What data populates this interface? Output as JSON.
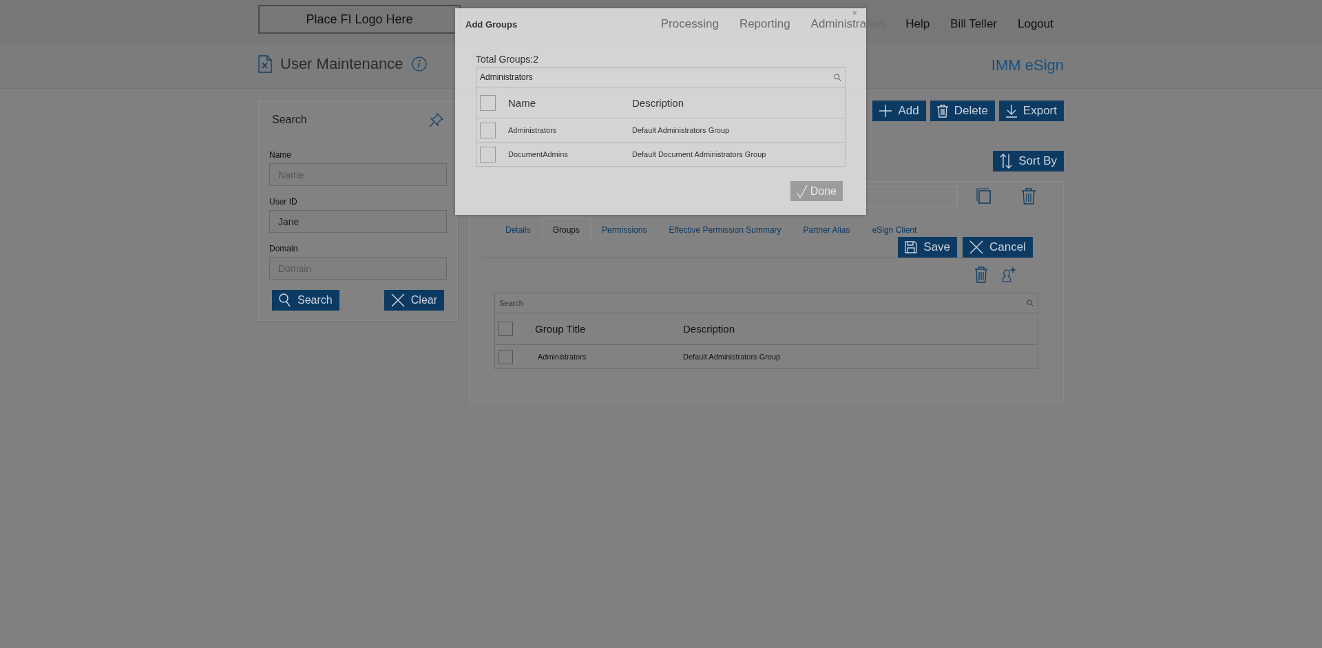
{
  "header": {
    "logo": "Place FI Logo Here",
    "nav": [
      {
        "label": "Processing"
      },
      {
        "label": "Reporting"
      },
      {
        "label": "Administration"
      },
      {
        "label": "Help"
      },
      {
        "label": "Bill Teller"
      },
      {
        "label": "Logout"
      }
    ]
  },
  "page": {
    "title": "User Maintenance",
    "app_name": "IMM eSign"
  },
  "search_panel": {
    "title": "Search",
    "fields": [
      {
        "label": "Name",
        "placeholder": "Name"
      },
      {
        "label": "User ID",
        "value": "Jane"
      },
      {
        "label": "Domain",
        "placeholder": "Domain"
      }
    ],
    "buttons": [
      {
        "label": "Search",
        "kind": "search"
      },
      {
        "label": "Clear",
        "kind": "clear"
      }
    ]
  },
  "toolbar": [
    {
      "label": "Add",
      "kind": "add"
    },
    {
      "label": "Delete",
      "kind": "delete"
    },
    {
      "label": "Export",
      "kind": "export"
    }
  ],
  "sort_button": {
    "label": "Sort By"
  },
  "user_card": {
    "tabs": [
      {
        "label": "Details",
        "selected": false
      },
      {
        "label": "Groups",
        "selected": true
      },
      {
        "label": "Permissions",
        "selected": false
      },
      {
        "label": "Effective Permission Summary",
        "selected": false
      },
      {
        "label": "Partner Alias",
        "selected": false
      },
      {
        "label": "eSign Client",
        "selected": false
      }
    ],
    "actions": [
      {
        "label": "Save",
        "kind": "save"
      },
      {
        "label": "Cancel",
        "kind": "cancel"
      }
    ],
    "groups_table": {
      "search_placeholder": "Search",
      "all_checked": false,
      "columns": [
        "Group Title",
        "Description"
      ],
      "rows": [
        {
          "checked": false,
          "cells": [
            "Administrators",
            "Default Administrators Group"
          ]
        }
      ]
    }
  },
  "dialog": {
    "title": "Add Groups",
    "close": "×",
    "total": "Total Groups:2",
    "search_value": "Administrators",
    "all_checked": false,
    "columns": [
      "Name",
      "Description"
    ],
    "rows": [
      {
        "checked": false,
        "cells": [
          "Administrators",
          "Default Administrators Group"
        ]
      },
      {
        "checked": false,
        "cells": [
          "DocumentAdmins",
          "Default Document Administrators Group"
        ]
      }
    ],
    "done": "Done"
  }
}
